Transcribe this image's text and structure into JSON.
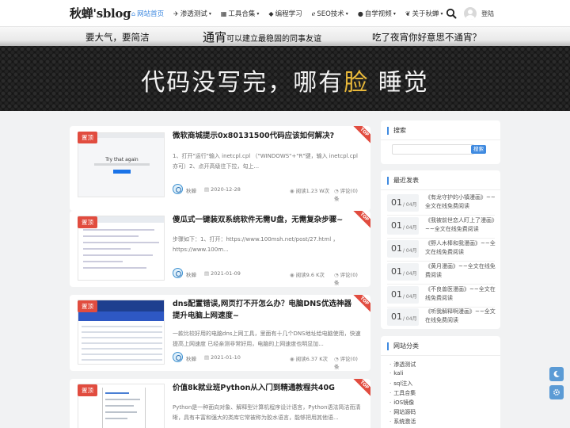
{
  "site": {
    "logo": "秋蝉'sblog"
  },
  "nav": {
    "items": [
      {
        "icon": "home-icon",
        "glyph": "⌂",
        "label": "网站首页",
        "caret": ""
      },
      {
        "icon": "rocket-icon",
        "glyph": "✈",
        "label": "渗透测试",
        "caret": "▾"
      },
      {
        "icon": "toolbox-icon",
        "glyph": "▦",
        "label": "工具合集",
        "caret": "▾"
      },
      {
        "icon": "diamond-icon",
        "glyph": "◆",
        "label": "编程学习",
        "caret": ""
      },
      {
        "icon": "edge-icon",
        "glyph": "ℯ",
        "label": "SEO技术",
        "caret": "▾"
      },
      {
        "icon": "github-icon",
        "glyph": "●",
        "label": "自学视频",
        "caret": "▾"
      },
      {
        "icon": "leaf-icon",
        "glyph": "❦",
        "label": "关于秋蝉",
        "caret": "▾"
      }
    ],
    "login": "登陆"
  },
  "banner": {
    "top1": "要大气，要简洁",
    "top2": "通宵",
    "top3": "可以建立最稳固的同事友谊",
    "top4": "吃了夜宵你好意思不通宵？",
    "main_a": "代码没写完，哪有",
    "main_b": "脸",
    "main_c": " 睡觉"
  },
  "posts": [
    {
      "badge": "置顶",
      "corner": "TOP",
      "title": "微软商城提示0x80131500代码应该如何解决?",
      "excerpt": "1、打开\"运行\"输入 inetcpl.cpl （\"WINDOWS\"+\"R\"键，输入 inetcpl.cpl亦可）2、点开高级往下拉，勾上...",
      "author": "秋蝉",
      "date": "2020-12-28",
      "views": "阅读1.23 W次",
      "comments": "评论(0)条",
      "thumb_text": "Try that again"
    },
    {
      "badge": "置顶",
      "corner": "TOP",
      "title": "傻瓜式一键装双系统软件无需U盘，无需复杂步骤~",
      "excerpt": "步骤如下：1、打开：https://www.100msh.net/post/27.html ，https://www.100m...",
      "author": "秋蝉",
      "date": "2021-01-09",
      "views": "阅读9.6 K次",
      "comments": "评论(0)条"
    },
    {
      "badge": "置顶",
      "corner": "TOP",
      "title": "dns配置错误,网页打不开怎么办？电脑DNS优选神器提升电脑上网速度~",
      "excerpt": "一款比较好用的电脑dns上网工具，里面有十几个DNS地址给电脑使用，快速提高上网速度 已经亲测非常好用，电脑的上网速度也明显加...",
      "author": "秋蝉",
      "date": "2021-01-10",
      "views": "阅读6.37 K次",
      "comments": "评论(0)条"
    },
    {
      "badge": "置顶",
      "corner": "TOP",
      "title": "价值8k就业班Python从入门到精通教程共40G",
      "excerpt": "Python是一种面向对象、解释型计算机程序设计语言，Python语法简洁而清晰，具有丰富和强大的类库它常被称为胶水语言，能够把用其他语..."
    }
  ],
  "sidebar": {
    "search": {
      "title": "搜索",
      "placeholder": "",
      "button": "搜索"
    },
    "recent": {
      "title": "最近发表",
      "items": [
        {
          "day": "01",
          "mon": "/ 04月",
          "title": "《有龙守护的小镇漫画》~~全文在线免费阅读"
        },
        {
          "day": "01",
          "mon": "/ 04月",
          "title": "《我被前世恋人盯上了漫画》~~全文在线免费阅读"
        },
        {
          "day": "01",
          "mon": "/ 04月",
          "title": "《野人木棒和我漫画》~~全文在线免费阅读"
        },
        {
          "day": "01",
          "mon": "/ 04月",
          "title": "《黄月漫画》~~全文在线免费阅读"
        },
        {
          "day": "01",
          "mon": "/ 04月",
          "title": "《不良兽医漫画》~~全文在线免费阅读"
        },
        {
          "day": "01",
          "mon": "/ 04月",
          "title": "《听我解释啊漫画》~~全文在线免费阅读"
        }
      ]
    },
    "categories": {
      "title": "网站分类",
      "items": [
        "渗透测试",
        "kali",
        "sql注入",
        "工具合集",
        "iOS镜像",
        "网站源码",
        "系统激活"
      ]
    }
  },
  "colors": {
    "accent": "#3f8ae0",
    "badge": "#e14c3f",
    "float": "#5b9bd5"
  }
}
